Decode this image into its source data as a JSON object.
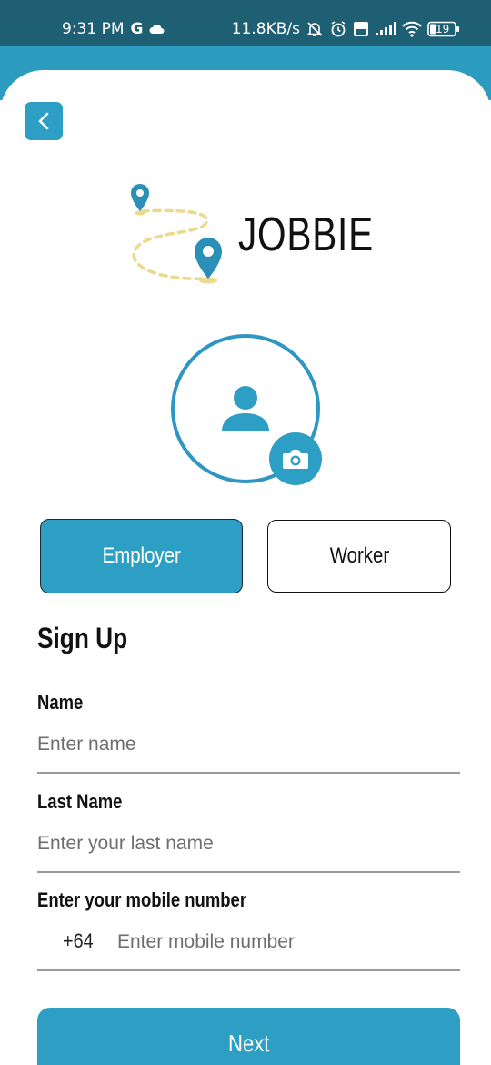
{
  "status_bar": {
    "time": "9:31 PM",
    "carrier_letter": "G",
    "net_speed": "11.8KB/s",
    "battery_level": "19",
    "icons": [
      "cloud-icon",
      "mute-icon",
      "alarm-icon",
      "volte-icon",
      "signal-icon",
      "wifi-icon",
      "battery-icon"
    ]
  },
  "header": {
    "back_icon": "chevron-left-icon"
  },
  "logo": {
    "text": "JOBBIE"
  },
  "avatar": {
    "icon": "person-icon",
    "camera_icon": "camera-icon"
  },
  "roles": {
    "employer_label": "Employer",
    "worker_label": "Worker",
    "selected": "Employer"
  },
  "form": {
    "title": "Sign Up",
    "name_label": "Name",
    "name_placeholder": "Enter name",
    "last_name_label": "Last Name",
    "last_name_placeholder": "Enter your last name",
    "mobile_label": "Enter your mobile number",
    "country_code": "+64",
    "mobile_placeholder": "Enter mobile number"
  },
  "next_label": "Next",
  "colors": {
    "status_bar": "#1f5f73",
    "accent": "#2e9fc4",
    "logo_pin": "#2b8fb8",
    "logo_path": "#ecd98c"
  }
}
